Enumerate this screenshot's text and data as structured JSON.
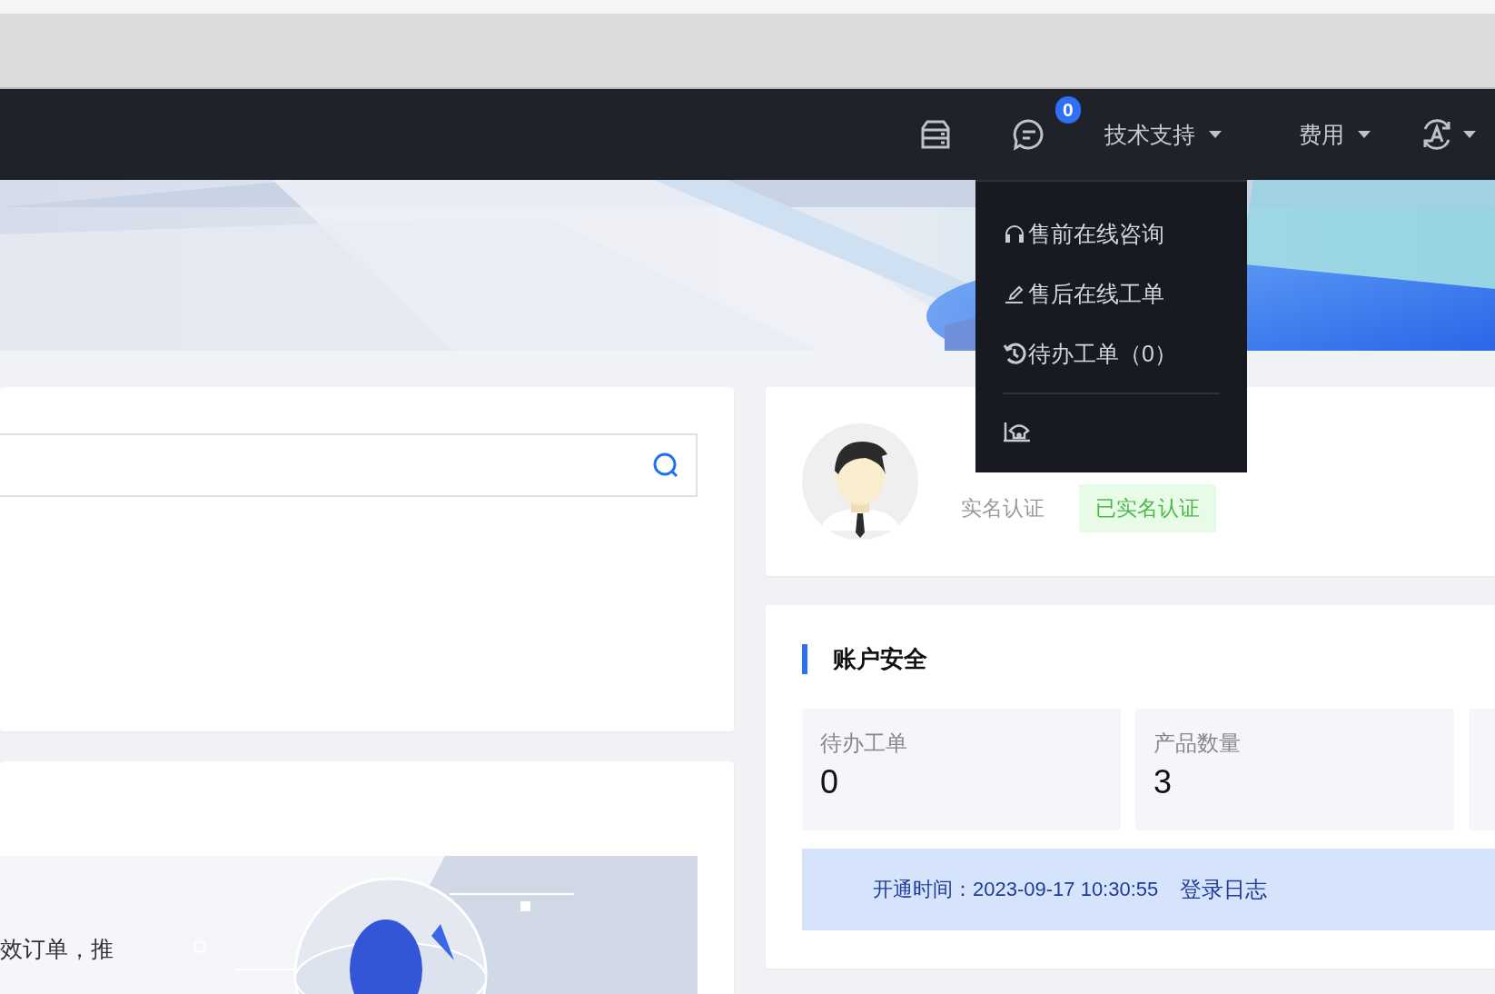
{
  "nav": {
    "badge": "0",
    "menus": [
      {
        "label": "技术支持"
      },
      {
        "label": "费用"
      }
    ]
  },
  "dropdown": {
    "items": [
      {
        "kind": "headset",
        "label": "售前在线咨询"
      },
      {
        "kind": "pen",
        "label": "售后在线工单"
      },
      {
        "kind": "history",
        "label": "待办工单（0）"
      },
      {
        "kind": "phone"
      }
    ]
  },
  "profile": {
    "verify_label": "实名认证",
    "verify_status": "已实名认证"
  },
  "promo": {
    "text": "效订单，推"
  },
  "security": {
    "title": "账户安全",
    "stats": [
      {
        "label": "待办工单",
        "value": "0"
      },
      {
        "label": "产品数量",
        "value": "3"
      }
    ],
    "open_time": "开通时间：2023-09-17 10:30:55",
    "log_link": "登录日志"
  }
}
